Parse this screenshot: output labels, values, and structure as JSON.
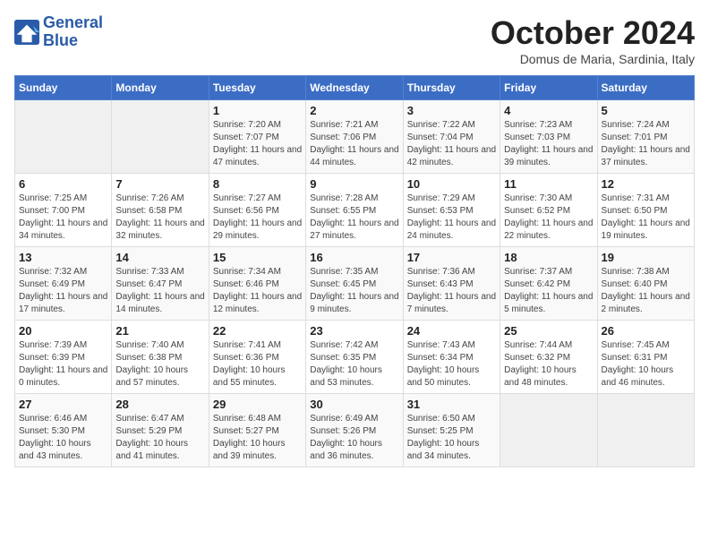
{
  "logo": {
    "line1": "General",
    "line2": "Blue"
  },
  "title": "October 2024",
  "subtitle": "Domus de Maria, Sardinia, Italy",
  "days_of_week": [
    "Sunday",
    "Monday",
    "Tuesday",
    "Wednesday",
    "Thursday",
    "Friday",
    "Saturday"
  ],
  "weeks": [
    [
      {
        "day": "",
        "info": ""
      },
      {
        "day": "",
        "info": ""
      },
      {
        "day": "1",
        "info": "Sunrise: 7:20 AM\nSunset: 7:07 PM\nDaylight: 11 hours and 47 minutes."
      },
      {
        "day": "2",
        "info": "Sunrise: 7:21 AM\nSunset: 7:06 PM\nDaylight: 11 hours and 44 minutes."
      },
      {
        "day": "3",
        "info": "Sunrise: 7:22 AM\nSunset: 7:04 PM\nDaylight: 11 hours and 42 minutes."
      },
      {
        "day": "4",
        "info": "Sunrise: 7:23 AM\nSunset: 7:03 PM\nDaylight: 11 hours and 39 minutes."
      },
      {
        "day": "5",
        "info": "Sunrise: 7:24 AM\nSunset: 7:01 PM\nDaylight: 11 hours and 37 minutes."
      }
    ],
    [
      {
        "day": "6",
        "info": "Sunrise: 7:25 AM\nSunset: 7:00 PM\nDaylight: 11 hours and 34 minutes."
      },
      {
        "day": "7",
        "info": "Sunrise: 7:26 AM\nSunset: 6:58 PM\nDaylight: 11 hours and 32 minutes."
      },
      {
        "day": "8",
        "info": "Sunrise: 7:27 AM\nSunset: 6:56 PM\nDaylight: 11 hours and 29 minutes."
      },
      {
        "day": "9",
        "info": "Sunrise: 7:28 AM\nSunset: 6:55 PM\nDaylight: 11 hours and 27 minutes."
      },
      {
        "day": "10",
        "info": "Sunrise: 7:29 AM\nSunset: 6:53 PM\nDaylight: 11 hours and 24 minutes."
      },
      {
        "day": "11",
        "info": "Sunrise: 7:30 AM\nSunset: 6:52 PM\nDaylight: 11 hours and 22 minutes."
      },
      {
        "day": "12",
        "info": "Sunrise: 7:31 AM\nSunset: 6:50 PM\nDaylight: 11 hours and 19 minutes."
      }
    ],
    [
      {
        "day": "13",
        "info": "Sunrise: 7:32 AM\nSunset: 6:49 PM\nDaylight: 11 hours and 17 minutes."
      },
      {
        "day": "14",
        "info": "Sunrise: 7:33 AM\nSunset: 6:47 PM\nDaylight: 11 hours and 14 minutes."
      },
      {
        "day": "15",
        "info": "Sunrise: 7:34 AM\nSunset: 6:46 PM\nDaylight: 11 hours and 12 minutes."
      },
      {
        "day": "16",
        "info": "Sunrise: 7:35 AM\nSunset: 6:45 PM\nDaylight: 11 hours and 9 minutes."
      },
      {
        "day": "17",
        "info": "Sunrise: 7:36 AM\nSunset: 6:43 PM\nDaylight: 11 hours and 7 minutes."
      },
      {
        "day": "18",
        "info": "Sunrise: 7:37 AM\nSunset: 6:42 PM\nDaylight: 11 hours and 5 minutes."
      },
      {
        "day": "19",
        "info": "Sunrise: 7:38 AM\nSunset: 6:40 PM\nDaylight: 11 hours and 2 minutes."
      }
    ],
    [
      {
        "day": "20",
        "info": "Sunrise: 7:39 AM\nSunset: 6:39 PM\nDaylight: 11 hours and 0 minutes."
      },
      {
        "day": "21",
        "info": "Sunrise: 7:40 AM\nSunset: 6:38 PM\nDaylight: 10 hours and 57 minutes."
      },
      {
        "day": "22",
        "info": "Sunrise: 7:41 AM\nSunset: 6:36 PM\nDaylight: 10 hours and 55 minutes."
      },
      {
        "day": "23",
        "info": "Sunrise: 7:42 AM\nSunset: 6:35 PM\nDaylight: 10 hours and 53 minutes."
      },
      {
        "day": "24",
        "info": "Sunrise: 7:43 AM\nSunset: 6:34 PM\nDaylight: 10 hours and 50 minutes."
      },
      {
        "day": "25",
        "info": "Sunrise: 7:44 AM\nSunset: 6:32 PM\nDaylight: 10 hours and 48 minutes."
      },
      {
        "day": "26",
        "info": "Sunrise: 7:45 AM\nSunset: 6:31 PM\nDaylight: 10 hours and 46 minutes."
      }
    ],
    [
      {
        "day": "27",
        "info": "Sunrise: 6:46 AM\nSunset: 5:30 PM\nDaylight: 10 hours and 43 minutes."
      },
      {
        "day": "28",
        "info": "Sunrise: 6:47 AM\nSunset: 5:29 PM\nDaylight: 10 hours and 41 minutes."
      },
      {
        "day": "29",
        "info": "Sunrise: 6:48 AM\nSunset: 5:27 PM\nDaylight: 10 hours and 39 minutes."
      },
      {
        "day": "30",
        "info": "Sunrise: 6:49 AM\nSunset: 5:26 PM\nDaylight: 10 hours and 36 minutes."
      },
      {
        "day": "31",
        "info": "Sunrise: 6:50 AM\nSunset: 5:25 PM\nDaylight: 10 hours and 34 minutes."
      },
      {
        "day": "",
        "info": ""
      },
      {
        "day": "",
        "info": ""
      }
    ]
  ]
}
